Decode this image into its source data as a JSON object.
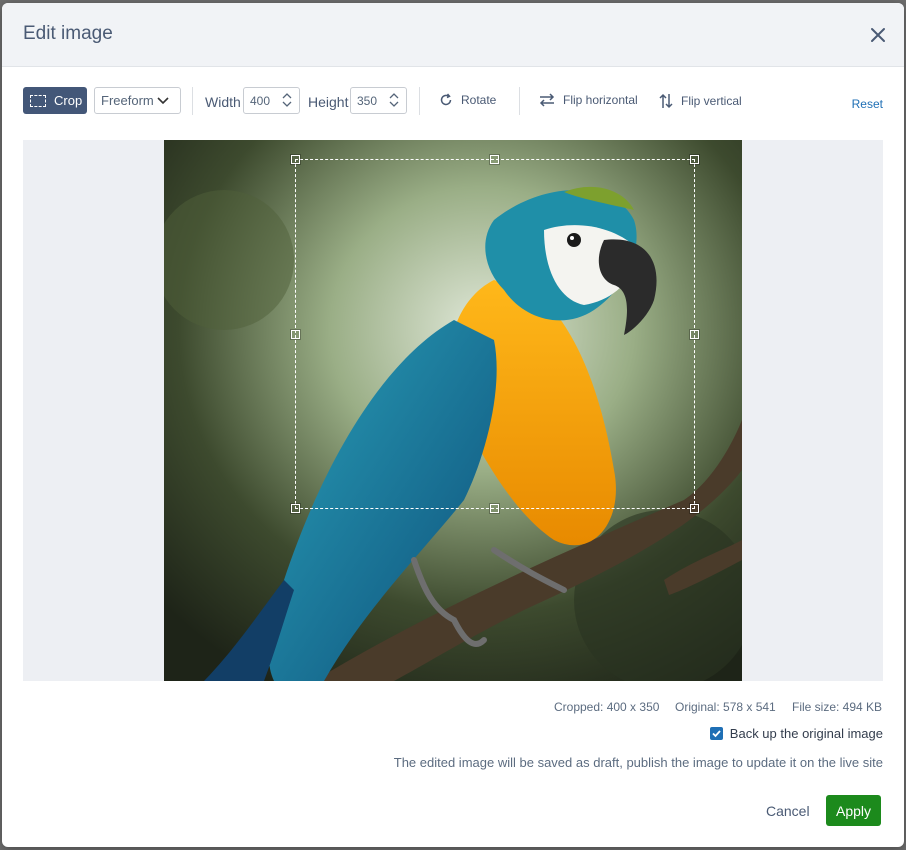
{
  "dialog": {
    "title": "Edit image"
  },
  "toolbar": {
    "crop_label": "Crop",
    "aspect_selected": "Freeform",
    "width_label": "Width",
    "width_value": "400",
    "height_label": "Height",
    "height_value": "350",
    "rotate_label": "Rotate",
    "flip_horizontal_label": "Flip horizontal",
    "flip_vertical_label": "Flip vertical",
    "reset_label": "Reset"
  },
  "info": {
    "cropped": "Cropped: 400 x 350",
    "original": "Original: 578 x 541",
    "file_size": "File size: 494 KB"
  },
  "backup": {
    "label": "Back up the original image",
    "checked": true
  },
  "note": "The edited image will be saved as draft, publish the image to update it on the live site",
  "footer": {
    "cancel_label": "Cancel",
    "apply_label": "Apply"
  },
  "colors": {
    "accent": "#435778",
    "link": "#1f6fb5",
    "apply": "#1c8a1c"
  },
  "icons": [
    "close-icon",
    "crop-icon",
    "chevron-down-icon",
    "rotate-icon",
    "flip-horizontal-icon",
    "flip-vertical-icon",
    "checkbox-checked-icon"
  ]
}
